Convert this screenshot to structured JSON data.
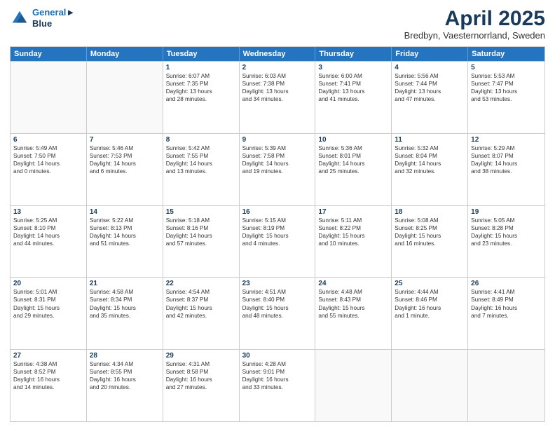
{
  "header": {
    "logo_line1": "General",
    "logo_line2": "Blue",
    "month_title": "April 2025",
    "location": "Bredbyn, Vaesternorrland, Sweden"
  },
  "days_of_week": [
    "Sunday",
    "Monday",
    "Tuesday",
    "Wednesday",
    "Thursday",
    "Friday",
    "Saturday"
  ],
  "weeks": [
    [
      {
        "day": "",
        "lines": []
      },
      {
        "day": "",
        "lines": []
      },
      {
        "day": "1",
        "lines": [
          "Sunrise: 6:07 AM",
          "Sunset: 7:35 PM",
          "Daylight: 13 hours",
          "and 28 minutes."
        ]
      },
      {
        "day": "2",
        "lines": [
          "Sunrise: 6:03 AM",
          "Sunset: 7:38 PM",
          "Daylight: 13 hours",
          "and 34 minutes."
        ]
      },
      {
        "day": "3",
        "lines": [
          "Sunrise: 6:00 AM",
          "Sunset: 7:41 PM",
          "Daylight: 13 hours",
          "and 41 minutes."
        ]
      },
      {
        "day": "4",
        "lines": [
          "Sunrise: 5:56 AM",
          "Sunset: 7:44 PM",
          "Daylight: 13 hours",
          "and 47 minutes."
        ]
      },
      {
        "day": "5",
        "lines": [
          "Sunrise: 5:53 AM",
          "Sunset: 7:47 PM",
          "Daylight: 13 hours",
          "and 53 minutes."
        ]
      }
    ],
    [
      {
        "day": "6",
        "lines": [
          "Sunrise: 5:49 AM",
          "Sunset: 7:50 PM",
          "Daylight: 14 hours",
          "and 0 minutes."
        ]
      },
      {
        "day": "7",
        "lines": [
          "Sunrise: 5:46 AM",
          "Sunset: 7:53 PM",
          "Daylight: 14 hours",
          "and 6 minutes."
        ]
      },
      {
        "day": "8",
        "lines": [
          "Sunrise: 5:42 AM",
          "Sunset: 7:55 PM",
          "Daylight: 14 hours",
          "and 13 minutes."
        ]
      },
      {
        "day": "9",
        "lines": [
          "Sunrise: 5:39 AM",
          "Sunset: 7:58 PM",
          "Daylight: 14 hours",
          "and 19 minutes."
        ]
      },
      {
        "day": "10",
        "lines": [
          "Sunrise: 5:36 AM",
          "Sunset: 8:01 PM",
          "Daylight: 14 hours",
          "and 25 minutes."
        ]
      },
      {
        "day": "11",
        "lines": [
          "Sunrise: 5:32 AM",
          "Sunset: 8:04 PM",
          "Daylight: 14 hours",
          "and 32 minutes."
        ]
      },
      {
        "day": "12",
        "lines": [
          "Sunrise: 5:29 AM",
          "Sunset: 8:07 PM",
          "Daylight: 14 hours",
          "and 38 minutes."
        ]
      }
    ],
    [
      {
        "day": "13",
        "lines": [
          "Sunrise: 5:25 AM",
          "Sunset: 8:10 PM",
          "Daylight: 14 hours",
          "and 44 minutes."
        ]
      },
      {
        "day": "14",
        "lines": [
          "Sunrise: 5:22 AM",
          "Sunset: 8:13 PM",
          "Daylight: 14 hours",
          "and 51 minutes."
        ]
      },
      {
        "day": "15",
        "lines": [
          "Sunrise: 5:18 AM",
          "Sunset: 8:16 PM",
          "Daylight: 14 hours",
          "and 57 minutes."
        ]
      },
      {
        "day": "16",
        "lines": [
          "Sunrise: 5:15 AM",
          "Sunset: 8:19 PM",
          "Daylight: 15 hours",
          "and 4 minutes."
        ]
      },
      {
        "day": "17",
        "lines": [
          "Sunrise: 5:11 AM",
          "Sunset: 8:22 PM",
          "Daylight: 15 hours",
          "and 10 minutes."
        ]
      },
      {
        "day": "18",
        "lines": [
          "Sunrise: 5:08 AM",
          "Sunset: 8:25 PM",
          "Daylight: 15 hours",
          "and 16 minutes."
        ]
      },
      {
        "day": "19",
        "lines": [
          "Sunrise: 5:05 AM",
          "Sunset: 8:28 PM",
          "Daylight: 15 hours",
          "and 23 minutes."
        ]
      }
    ],
    [
      {
        "day": "20",
        "lines": [
          "Sunrise: 5:01 AM",
          "Sunset: 8:31 PM",
          "Daylight: 15 hours",
          "and 29 minutes."
        ]
      },
      {
        "day": "21",
        "lines": [
          "Sunrise: 4:58 AM",
          "Sunset: 8:34 PM",
          "Daylight: 15 hours",
          "and 35 minutes."
        ]
      },
      {
        "day": "22",
        "lines": [
          "Sunrise: 4:54 AM",
          "Sunset: 8:37 PM",
          "Daylight: 15 hours",
          "and 42 minutes."
        ]
      },
      {
        "day": "23",
        "lines": [
          "Sunrise: 4:51 AM",
          "Sunset: 8:40 PM",
          "Daylight: 15 hours",
          "and 48 minutes."
        ]
      },
      {
        "day": "24",
        "lines": [
          "Sunrise: 4:48 AM",
          "Sunset: 8:43 PM",
          "Daylight: 15 hours",
          "and 55 minutes."
        ]
      },
      {
        "day": "25",
        "lines": [
          "Sunrise: 4:44 AM",
          "Sunset: 8:46 PM",
          "Daylight: 16 hours",
          "and 1 minute."
        ]
      },
      {
        "day": "26",
        "lines": [
          "Sunrise: 4:41 AM",
          "Sunset: 8:49 PM",
          "Daylight: 16 hours",
          "and 7 minutes."
        ]
      }
    ],
    [
      {
        "day": "27",
        "lines": [
          "Sunrise: 4:38 AM",
          "Sunset: 8:52 PM",
          "Daylight: 16 hours",
          "and 14 minutes."
        ]
      },
      {
        "day": "28",
        "lines": [
          "Sunrise: 4:34 AM",
          "Sunset: 8:55 PM",
          "Daylight: 16 hours",
          "and 20 minutes."
        ]
      },
      {
        "day": "29",
        "lines": [
          "Sunrise: 4:31 AM",
          "Sunset: 8:58 PM",
          "Daylight: 16 hours",
          "and 27 minutes."
        ]
      },
      {
        "day": "30",
        "lines": [
          "Sunrise: 4:28 AM",
          "Sunset: 9:01 PM",
          "Daylight: 16 hours",
          "and 33 minutes."
        ]
      },
      {
        "day": "",
        "lines": []
      },
      {
        "day": "",
        "lines": []
      },
      {
        "day": "",
        "lines": []
      }
    ]
  ]
}
